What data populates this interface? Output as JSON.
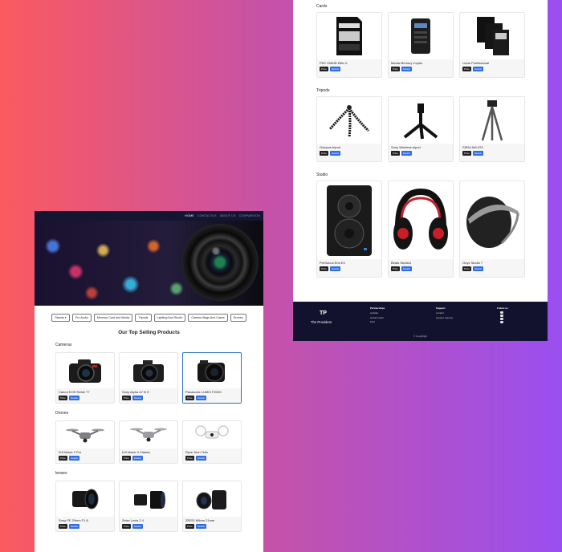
{
  "left_page": {
    "nav": {
      "home": "HOME",
      "contact": "CONTACTUS",
      "about": "ABOUT US",
      "comparison": "COMPARISON"
    },
    "categories": [
      "Stands",
      "Pro Audio",
      "Memory Card and Media",
      "Tripods",
      "Lighting And Studio",
      "Camera Bags And Cases",
      "Drones"
    ],
    "section_title": "Our Top Selling Products",
    "groups": [
      {
        "title": "Cameras",
        "items": [
          "Canon EOS Rebel T7",
          "Sony Alpha a7 III E",
          "Panasonic LUMIX FZ300"
        ]
      },
      {
        "title": "Drones",
        "items": [
          "DJI Mavic 2 Pro",
          "DJI Mavic 3 Classic",
          "Ryze Tech Tello"
        ]
      },
      {
        "title": "lenses",
        "items": [
          "Sony FE 20mm F1.8",
          "Zeiss Loxia 2.4",
          "ZEISS Milvus 21mm"
        ]
      }
    ],
    "price_label": "Price",
    "details_label": "Details",
    "stands_caret": "▾"
  },
  "right_page": {
    "groups": [
      {
        "title": "Cards",
        "items": [
          "PNY 256GB Elite-X",
          "Media Memory Copier",
          "Lexar Professional"
        ]
      },
      {
        "title": "Tripods",
        "items": [
          "Octopus tripod",
          "Sony Wireless tripod",
          "SIRUI AM-223"
        ]
      },
      {
        "title": "Studio",
        "items": [
          "PreSonus Eris E3",
          "Beats Studio3",
          "Onyx Studio 7"
        ]
      }
    ],
    "price_label": "Price",
    "details_label": "Details",
    "footer": {
      "logo": "TP",
      "tagline": "The Providers",
      "partnerships": {
        "title": "Partnerships",
        "links": [
          "website",
          "social media",
          "links"
        ]
      },
      "support": {
        "title": "Support",
        "links": [
          "contact",
          "support request"
        ]
      },
      "follow": {
        "title": "Follow us"
      },
      "copyright": "© CopyRight"
    }
  },
  "colors": {
    "navbar": "#141531",
    "footer": "#12112e",
    "price_button": "#222222",
    "details_button": "#2f6de6"
  }
}
